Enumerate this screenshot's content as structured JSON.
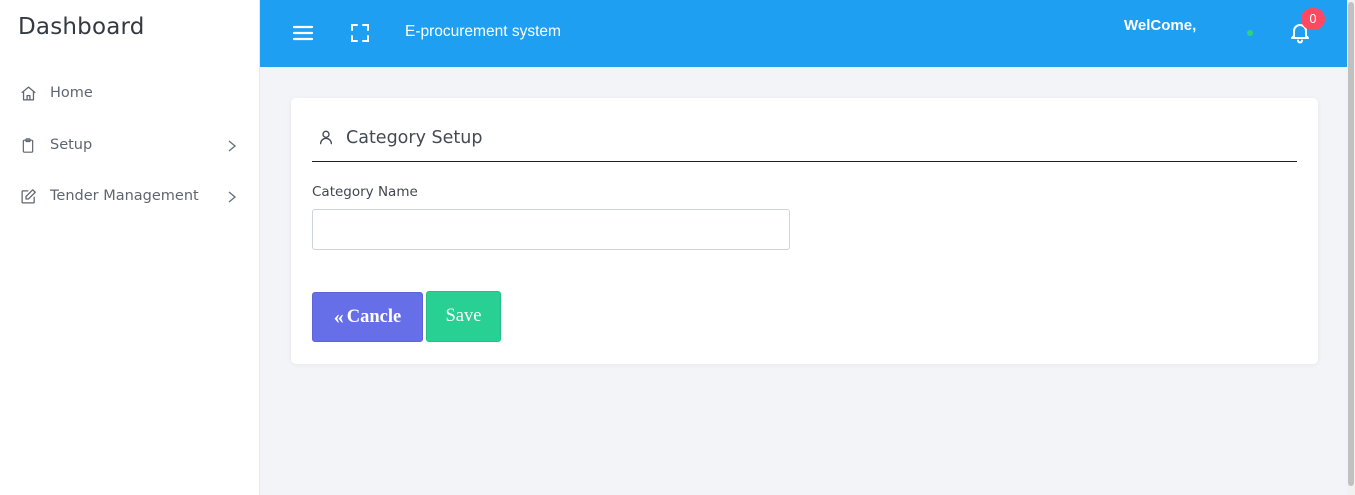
{
  "sidebar": {
    "brand": "Dashboard",
    "items": [
      {
        "label": "Home",
        "icon": "home-icon",
        "has_children": false
      },
      {
        "label": "Setup",
        "icon": "clipboard-icon",
        "has_children": true
      },
      {
        "label": "Tender Management",
        "icon": "edit-icon",
        "has_children": true
      }
    ]
  },
  "topbar": {
    "title": "E-procurement system",
    "welcome": "WelCome,",
    "notification_count": "0",
    "colors": {
      "bar": "#1e9ff2",
      "badge": "#ff4961",
      "status": "#2ed47a"
    }
  },
  "form": {
    "title": "Category Setup",
    "field_label": "Category Name",
    "field_value": "",
    "field_placeholder": "",
    "cancel_label": "Cancle",
    "save_label": "Save",
    "colors": {
      "cancel": "#666ee8",
      "save": "#28d094"
    }
  }
}
